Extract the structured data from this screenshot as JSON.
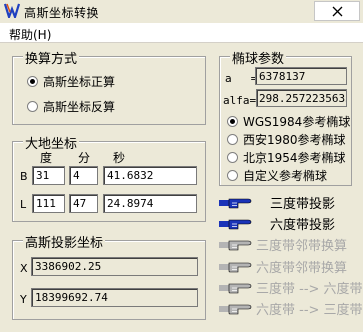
{
  "window": {
    "title": "高斯坐标转换"
  },
  "menu": {
    "help": "帮助(H)"
  },
  "calc_mode": {
    "title": "换算方式",
    "options": [
      {
        "label": "高斯坐标正算",
        "checked": true
      },
      {
        "label": "高斯坐标反算",
        "checked": false
      }
    ]
  },
  "geodetic": {
    "title": "大地坐标",
    "headers": {
      "deg": "度",
      "min": "分",
      "sec": "秒"
    },
    "B": {
      "label": "B",
      "deg": "31",
      "min": "4",
      "sec": "41.6832"
    },
    "L": {
      "label": "L",
      "deg": "111",
      "min": "47",
      "sec": "24.8974"
    }
  },
  "ellipsoid": {
    "title": "椭球参数",
    "a_label": "a",
    "a_value": "6378137",
    "alfa_label": "alfa=",
    "alfa_value": "298.2572235635",
    "options": [
      {
        "label": "WGS1984参考椭球",
        "checked": true
      },
      {
        "label": "西安1980参考椭球",
        "checked": false
      },
      {
        "label": "北京1954参考椭球",
        "checked": false
      },
      {
        "label": "自定义参考椭球",
        "checked": false
      }
    ]
  },
  "gauss": {
    "title": "高斯投影坐标",
    "X": {
      "label": "X",
      "value": "3386902.25"
    },
    "Y": {
      "label": "Y",
      "value": "18399692.74"
    }
  },
  "actions": [
    {
      "label": "三度带投影",
      "enabled": true
    },
    {
      "label": "六度带投影",
      "enabled": true
    },
    {
      "label": "三度带邻带换算",
      "enabled": false
    },
    {
      "label": "六度带邻带换算",
      "enabled": false
    },
    {
      "label": "三度带 --> 六度带",
      "enabled": false
    },
    {
      "label": "六度带 --> 三度带",
      "enabled": false
    }
  ],
  "icons": {
    "app": "gauss-app-icon",
    "close": "close-icon",
    "pointer": "pointing-hand-icon"
  },
  "colors": {
    "hand_enabled": "#1a33b8",
    "hand_disabled": "#b4b4b4",
    "text_disabled": "#a8a8a8",
    "window": "#ece9d8"
  }
}
